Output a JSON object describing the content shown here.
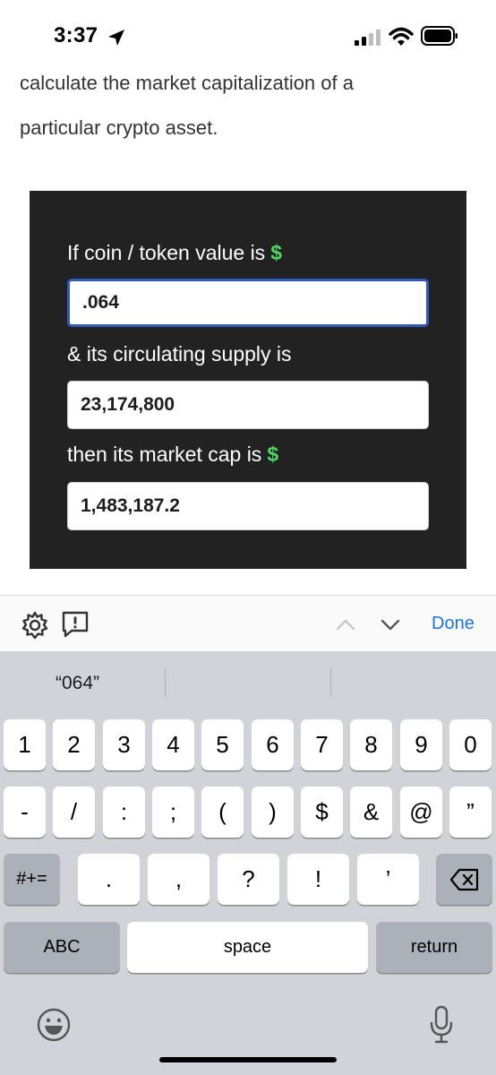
{
  "status_bar": {
    "time": "3:37"
  },
  "article": {
    "line1": "calculate the market capitalization of a",
    "line2": "particular crypto asset."
  },
  "calculator": {
    "label_value": "If coin / token value is",
    "dollar": "$",
    "value_input": ".064",
    "label_supply": "& its circulating supply is",
    "supply_input": "23,174,800",
    "label_cap": "then its market cap is",
    "cap_input": "1,483,187.2"
  },
  "toolbar": {
    "done": "Done",
    "icons": [
      "gear-icon",
      "feedback-icon",
      "chevron-up-icon",
      "chevron-down-icon"
    ]
  },
  "keyboard": {
    "suggestions": [
      "“064”",
      "",
      ""
    ],
    "row1": [
      "1",
      "2",
      "3",
      "4",
      "5",
      "6",
      "7",
      "8",
      "9",
      "0"
    ],
    "row2": [
      "-",
      "/",
      ":",
      ";",
      "(",
      ")",
      "$",
      "&",
      "@",
      "”"
    ],
    "row3_left": "#+=",
    "row3": [
      ".",
      ",",
      "?",
      "!",
      "’"
    ],
    "abc": "ABC",
    "space": "space",
    "return": "return"
  },
  "colors": {
    "accent": "#1a73e8",
    "dollar": "#4cd964",
    "calc_bg": "#222222",
    "focus": "#2e5bb8"
  }
}
